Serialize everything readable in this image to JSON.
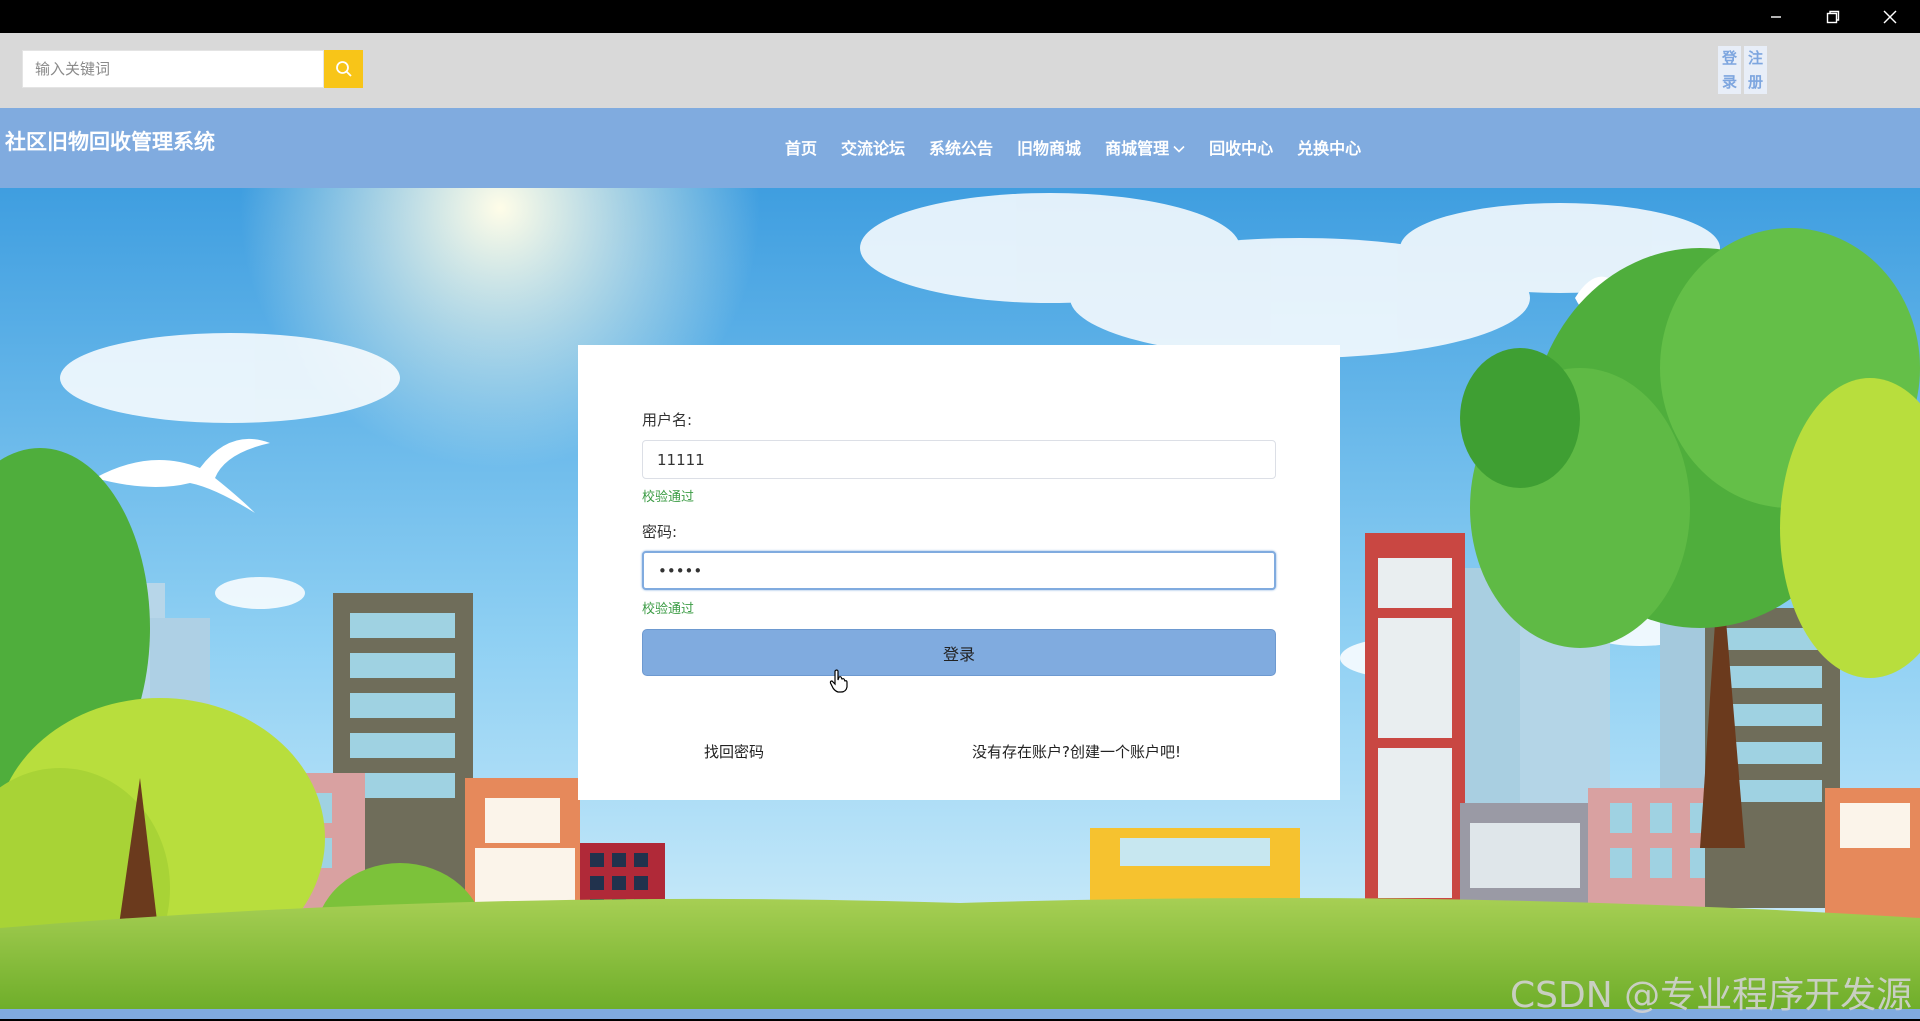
{
  "window": {
    "controls": [
      "minimize-icon",
      "restore-icon",
      "close-icon"
    ]
  },
  "search": {
    "placeholder": "输入关键词",
    "button_icon": "search-icon",
    "button_color": "#f8c518"
  },
  "auth": {
    "login": "登录",
    "register": "注册"
  },
  "header": {
    "brand": "社区旧物回收管理系统",
    "nav": [
      {
        "label": "首页"
      },
      {
        "label": "交流论坛"
      },
      {
        "label": "系统公告"
      },
      {
        "label": "旧物商城"
      },
      {
        "label": "商城管理",
        "icon": "chevron-down-icon"
      },
      {
        "label": "回收中心"
      },
      {
        "label": "兑换中心"
      }
    ],
    "accent": "#80abdf"
  },
  "login": {
    "username_label": "用户名:",
    "username_value": "11111",
    "username_hint": "校验通过",
    "password_label": "密码:",
    "password_value": "•••••",
    "password_hint": "校验通过",
    "submit_label": "登录",
    "forgot_link": "找回密码",
    "register_link": "没有存在账户?创建一个账户吧!",
    "hint_color": "#3c9c45"
  },
  "watermark": "CSDN @专业程序开发源"
}
